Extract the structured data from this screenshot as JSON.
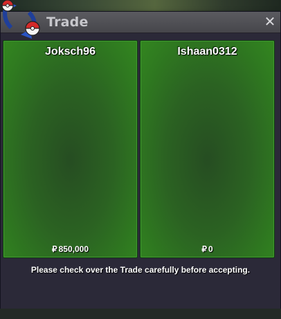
{
  "window": {
    "title": "Trade",
    "close_glyph": "✕"
  },
  "trade": {
    "left": {
      "player": "Joksch96",
      "currency_symbol": "₽",
      "money": "850,000"
    },
    "right": {
      "player": "Ishaan0312",
      "currency_symbol": "₽",
      "money": "0"
    }
  },
  "notice": "Please check over the Trade carefully before accepting.",
  "icons": {
    "logo": "trade-logo-icon",
    "close": "close-icon"
  },
  "colors": {
    "panel_green": "#2f7a20",
    "window_bg": "#2b2938",
    "titlebar": "#505055",
    "title_text": "#c7c7cc"
  }
}
